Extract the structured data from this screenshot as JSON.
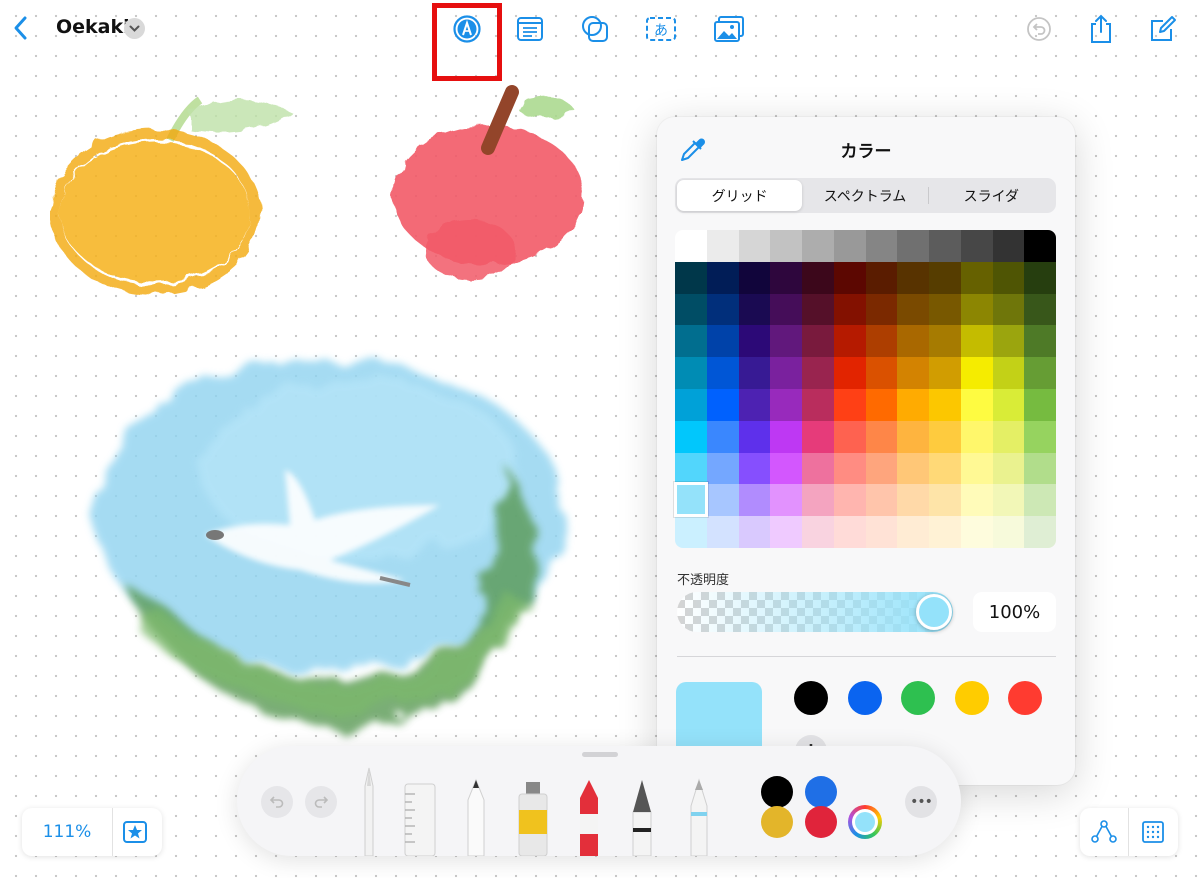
{
  "header": {
    "title": "Oekaki",
    "icons": [
      "back-chevron-icon",
      "title-menu-chevron-icon",
      "markup-pen-icon",
      "text-box-icon",
      "shapes-icon",
      "sticky-text-icon",
      "media-icon",
      "undo-icon",
      "share-icon",
      "new-board-icon"
    ]
  },
  "color_panel": {
    "title": "カラー",
    "tabs": [
      "グリッド",
      "スペクトラム",
      "スライダ"
    ],
    "active_tab": "グリッド",
    "grid_colors": [
      [
        "#ffffff",
        "#ebebeb",
        "#d6d6d6",
        "#c2c2c2",
        "#adadad",
        "#999999",
        "#858585",
        "#707070",
        "#5c5c5c",
        "#474747",
        "#333333",
        "#000000"
      ],
      [
        "#00374a",
        "#011d57",
        "#11053b",
        "#2e063d",
        "#3c071b",
        "#5c0701",
        "#5a1c00",
        "#583300",
        "#563d00",
        "#666100",
        "#4f5504",
        "#263e0f"
      ],
      [
        "#004d65",
        "#012f7b",
        "#1a0a52",
        "#450d59",
        "#551029",
        "#831100",
        "#7b2900",
        "#7a4a00",
        "#785800",
        "#8c8602",
        "#6f760a",
        "#38571a"
      ],
      [
        "#016e8f",
        "#0042a9",
        "#2c0977",
        "#61187c",
        "#791a3d",
        "#b51a00",
        "#ad3e00",
        "#a96800",
        "#a67b01",
        "#c4bc00",
        "#9ba50e",
        "#4e7a27"
      ],
      [
        "#008cb4",
        "#0056d6",
        "#371a94",
        "#7a219e",
        "#99244f",
        "#e22400",
        "#da5100",
        "#d38301",
        "#d19d01",
        "#f5ec00",
        "#c3d117",
        "#669d34"
      ],
      [
        "#00a1d8",
        "#0061fe",
        "#4d22b2",
        "#982abc",
        "#b92d5d",
        "#ff4015",
        "#ff6a00",
        "#ffab01",
        "#fcc700",
        "#fefb41",
        "#d9ec37",
        "#76bb40"
      ],
      [
        "#01c7fc",
        "#3a87fe",
        "#5e30eb",
        "#be38f3",
        "#e63b7a",
        "#fe6250",
        "#fe8648",
        "#feb43f",
        "#fecb3e",
        "#fff76b",
        "#e4ef65",
        "#96d35f"
      ],
      [
        "#52d6fc",
        "#74a7ff",
        "#864ffe",
        "#d357fe",
        "#ee719e",
        "#ff8c82",
        "#fea57d",
        "#ffc777",
        "#ffd977",
        "#fff994",
        "#eaf28f",
        "#b1dd8b"
      ],
      [
        "#93e3fc",
        "#a7c6ff",
        "#b18cfe",
        "#e292fe",
        "#f4a4c0",
        "#ffb5af",
        "#ffc5ab",
        "#ffd9a8",
        "#fee4a8",
        "#fffbb9",
        "#f2f7b7",
        "#cde8b5"
      ],
      [
        "#cbf0ff",
        "#d3e2ff",
        "#d9c9fe",
        "#efcaff",
        "#f9d3e0",
        "#ffdbd8",
        "#ffe2d6",
        "#ffecd4",
        "#fff2d5",
        "#fefcdd",
        "#f7fadb",
        "#dfeed4"
      ]
    ],
    "opacity_label": "不透明度",
    "opacity_value": "100%",
    "opacity_fraction": 1.0,
    "current_color": "#94e2fa",
    "favorites": [
      "#000000",
      "#0a64f0",
      "#2ec050",
      "#ffcc00",
      "#ff3b30"
    ],
    "add_label": "+"
  },
  "toolbar": {
    "tools": [
      "pencil",
      "ruler",
      "fineliner-pen",
      "paint-tube",
      "crayon",
      "fountain-pen",
      "watercolor-brush"
    ],
    "palette_colors": [
      "#000000",
      "#1f6fe6",
      "#e3b52a",
      "#e0243b"
    ],
    "more_label": "•••"
  },
  "zoom": {
    "label": "111%"
  },
  "bottom_right": {
    "icons": [
      "connector-icon",
      "grid-toggle-icon"
    ]
  }
}
